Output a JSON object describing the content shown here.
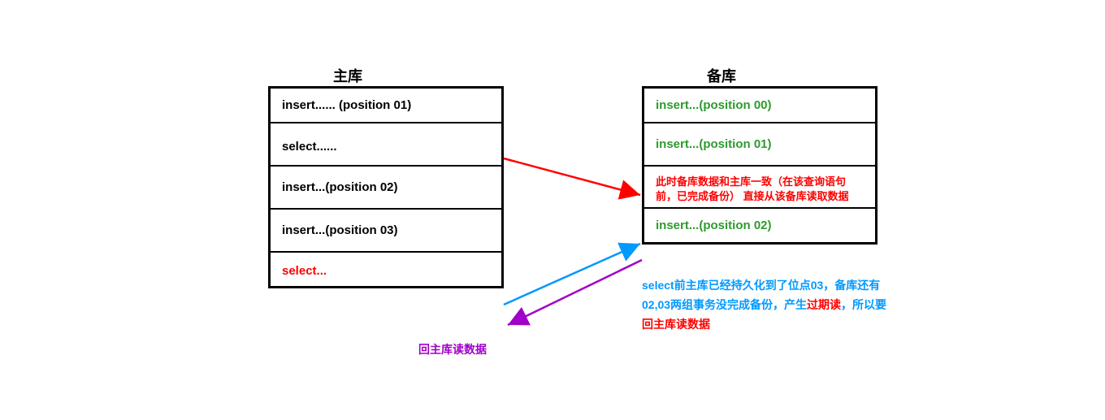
{
  "titles": {
    "left": "主库",
    "right": "备库"
  },
  "left_box": {
    "rows": [
      {
        "text": "insert...... (position 01)",
        "class": "black"
      },
      {
        "text": "select......",
        "class": "black"
      },
      {
        "text": "insert...(position 02)",
        "class": "black"
      },
      {
        "text": "insert...(position 03)",
        "class": "black"
      },
      {
        "text": "select...",
        "class": "red"
      }
    ]
  },
  "right_box": {
    "rows": [
      {
        "text": "insert...(position 00)",
        "class": "green"
      },
      {
        "text": "insert...(position 01)",
        "class": "green"
      },
      {
        "text": "此时备库数据和主库一致（在该查询语句前，已完成备份）  直接从该备库读取数据",
        "class": "red"
      },
      {
        "text": "insert...(position 02)",
        "class": "green"
      }
    ]
  },
  "bottom_note": {
    "seg1": "select前主库已经持久化到了位点03，备库还有02,03两组事务没完成备份，产生",
    "seg2": "过期读",
    "seg3": "，所以要",
    "seg4": "回主库读数据"
  },
  "purple_label": "回主库读数据",
  "colors": {
    "red": "#ff0000",
    "blue": "#0099ff",
    "purple": "#a000c8"
  }
}
